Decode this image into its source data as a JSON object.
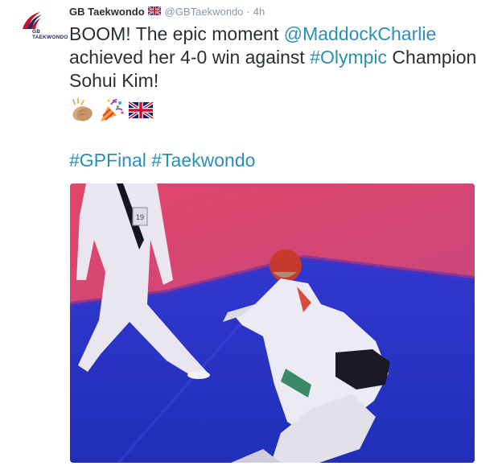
{
  "tweet": {
    "author": {
      "display_name": "GB Taekwondo",
      "handle": "@GBTaekwondo",
      "avatar_text_line1": "GB",
      "avatar_text_line2": "TAEKWONDO"
    },
    "separator": "·",
    "timestamp": "4h",
    "text": {
      "part1": "BOOM! The epic moment ",
      "mention": "@MaddockCharlie",
      "part2": " achieved her 4-0 win against ",
      "hashtag_olympic": "#Olympic",
      "part3": " Champion Sohui Kim!"
    },
    "emojis": [
      "clapping-hands",
      "party-popper",
      "union-jack-flag"
    ],
    "hashtags": [
      "#GPFinal",
      "#Taekwondo"
    ],
    "photo": {
      "description_icons": [
        "photo"
      ],
      "visible_text": "19"
    }
  },
  "colors": {
    "link": "#2a8fb6",
    "muted": "#8899a6",
    "text": "#292f33",
    "mat_blue": "#2a36c8",
    "wall_pink": "#d2476e"
  }
}
